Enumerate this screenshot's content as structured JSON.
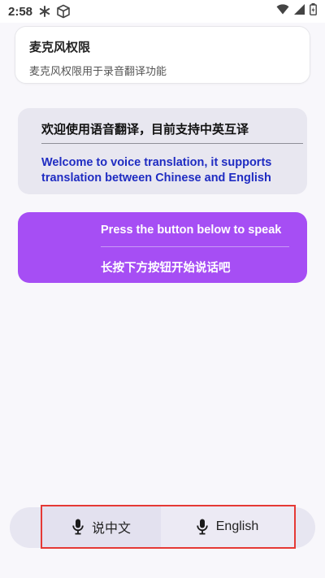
{
  "status_bar": {
    "time": "2:58",
    "icons": [
      "asterisk-icon",
      "cube-icon",
      "wifi-icon",
      "signal-icon",
      "battery-icon"
    ]
  },
  "permission": {
    "title": "麦克风权限",
    "description": "麦克风权限用于录音翻译功能"
  },
  "welcome": {
    "chinese": "欢迎使用语音翻译，目前支持中英互译",
    "english": "Welcome to voice translation, it supports translation between Chinese and English"
  },
  "instruction": {
    "english": "Press the button below to speak",
    "chinese": "长按下方按钮开始说话吧"
  },
  "buttons": {
    "chinese_label": "说中文",
    "english_label": "English",
    "icon": "microphone-icon"
  },
  "colors": {
    "accent": "#a64ef4",
    "english_text": "#1f2cc2",
    "highlight": "#e53935"
  }
}
